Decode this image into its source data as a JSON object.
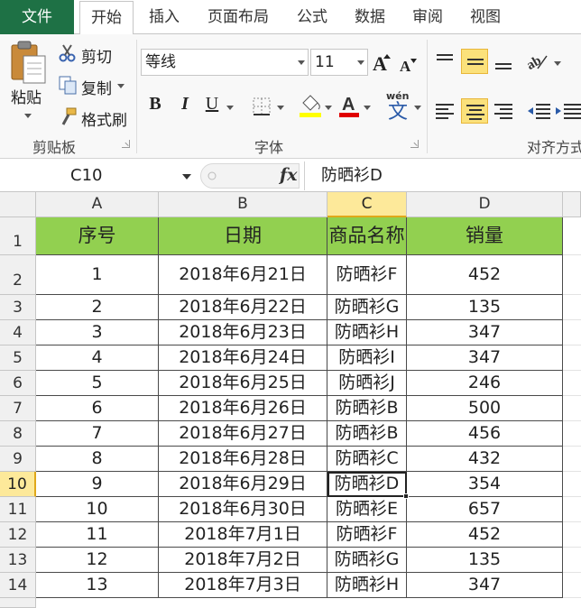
{
  "tabs": [
    "文件",
    "开始",
    "插入",
    "页面布局",
    "公式",
    "数据",
    "审阅",
    "视图"
  ],
  "ribbon": {
    "clipboard": {
      "paste": "粘贴",
      "cut": "剪切",
      "copy": "复制",
      "format_painter": "格式刷",
      "label": "剪贴板"
    },
    "font": {
      "font_name": "等线",
      "font_size": "11",
      "bold": "B",
      "italic": "I",
      "underline": "U",
      "label": "字体"
    },
    "alignment": {
      "label": "对齐方式"
    }
  },
  "formula_bar": {
    "name_box": "C10",
    "fx": "fx",
    "formula": "防晒衫D"
  },
  "columns": [
    "A",
    "B",
    "C",
    "D"
  ],
  "row_numbers": [
    "1",
    "2",
    "3",
    "4",
    "5",
    "6",
    "7",
    "8",
    "9",
    "10",
    "11",
    "12",
    "13",
    "14"
  ],
  "selected_cell": "C10",
  "table_header": [
    "序号",
    "日期",
    "商品名称",
    "销量"
  ],
  "rows": [
    [
      "1",
      "2018年6月21日",
      "防晒衫F",
      "452"
    ],
    [
      "2",
      "2018年6月22日",
      "防晒衫G",
      "135"
    ],
    [
      "3",
      "2018年6月23日",
      "防晒衫H",
      "347"
    ],
    [
      "4",
      "2018年6月24日",
      "防晒衫I",
      "347"
    ],
    [
      "5",
      "2018年6月25日",
      "防晒衫J",
      "246"
    ],
    [
      "6",
      "2018年6月26日",
      "防晒衫B",
      "500"
    ],
    [
      "7",
      "2018年6月27日",
      "防晒衫B",
      "456"
    ],
    [
      "8",
      "2018年6月28日",
      "防晒衫C",
      "432"
    ],
    [
      "9",
      "2018年6月29日",
      "防晒衫D",
      "354"
    ],
    [
      "10",
      "2018年6月30日",
      "防晒衫E",
      "657"
    ],
    [
      "11",
      "2018年7月1日",
      "防晒衫F",
      "452"
    ],
    [
      "12",
      "2018年7月2日",
      "防晒衫G",
      "135"
    ],
    [
      "13",
      "2018年7月3日",
      "防晒衫H",
      "347"
    ]
  ],
  "colors": {
    "header_fill": "#92d050",
    "file_tab": "#1e7145",
    "selection_highlight": "#fde99a"
  }
}
